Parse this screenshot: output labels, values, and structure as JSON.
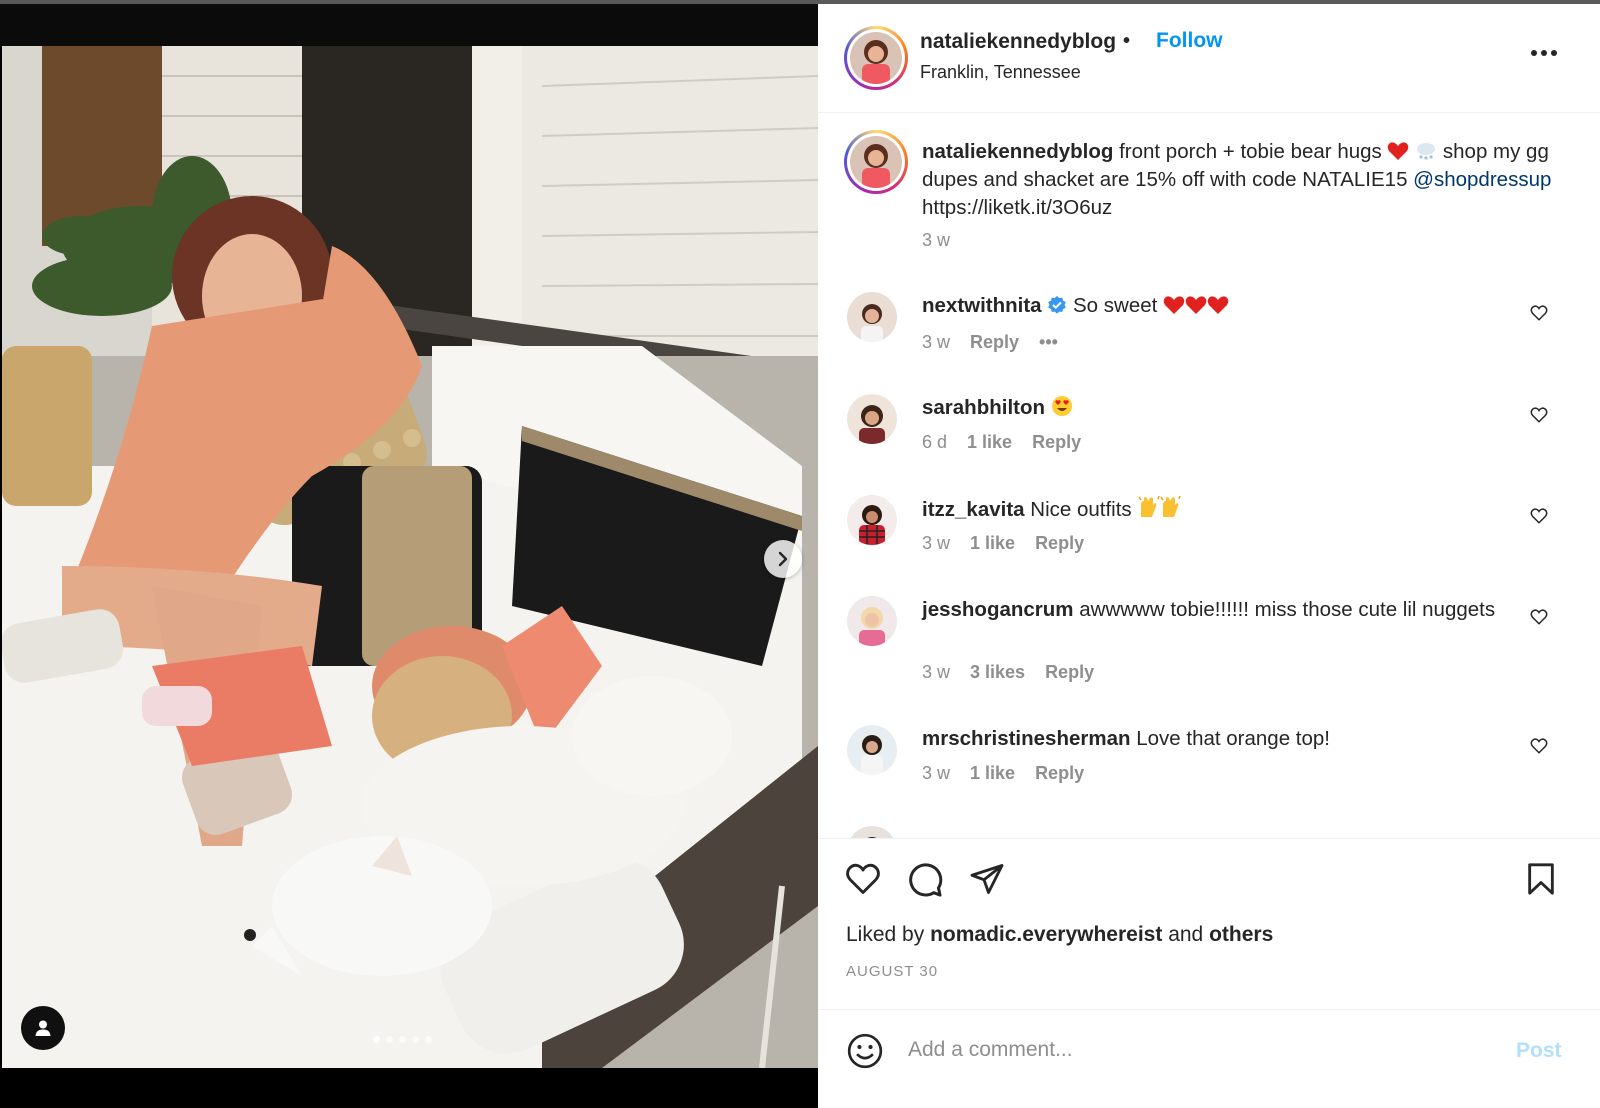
{
  "post": {
    "username": "nataliekennedyblog",
    "follow_label": "Follow",
    "separator": "•",
    "location": "Franklin, Tennessee",
    "caption": {
      "username": "nataliekennedyblog",
      "text_part1": "front porch + tobie bear hugs",
      "text_part2": "shop my gg dupes and shacket are 15% off with code NATALIE15",
      "mention": "@shopdressup",
      "link": "https://liketk.it/3O6uz",
      "time": "3 w"
    },
    "icons": {
      "more": "more-horizontal-icon",
      "heart": "heart-icon",
      "comment": "comment-icon",
      "share": "share-icon",
      "save": "bookmark-icon",
      "emoji": "emoji-icon",
      "next": "chevron-right-icon",
      "tag": "user-tag-icon"
    },
    "colors": {
      "accent": "#0095f6",
      "mention": "#00376b",
      "muted": "#8e8e8e",
      "post_disabled": "#b2dffc"
    }
  },
  "comments": [
    {
      "username": "nextwithnita",
      "verified": true,
      "text": "So sweet",
      "time": "3 w",
      "likes": "",
      "reply": "Reply",
      "more": "•••"
    },
    {
      "username": "sarahbhilton",
      "text": "",
      "time": "6 d",
      "likes": "1 like",
      "reply": "Reply"
    },
    {
      "username": "itzz_kavita",
      "text": "Nice outfits",
      "time": "3 w",
      "likes": "1 like",
      "reply": "Reply"
    },
    {
      "username": "jesshogancrum",
      "text": "awwwww tobie!!!!!! miss those cute lil nuggets",
      "time": "3 w",
      "likes": "3 likes",
      "reply": "Reply"
    },
    {
      "username": "mrschristinesherman",
      "text": "Love that orange top!",
      "time": "3 w",
      "likes": "1 like",
      "reply": "Reply"
    }
  ],
  "footer": {
    "liked_by_prefix": "Liked by",
    "liked_by_user": "nomadic.everywhereist",
    "liked_by_and": "and",
    "liked_by_others": "others",
    "date": "AUGUST 30",
    "comment_placeholder": "Add a comment...",
    "post_label": "Post"
  },
  "carousel": {
    "count": 5,
    "active": 0
  }
}
